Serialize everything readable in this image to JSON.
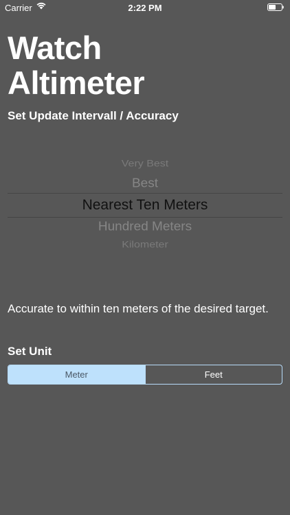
{
  "status_bar": {
    "carrier": "Carrier",
    "time": "2:22 PM",
    "wifi_icon": "wifi-icon",
    "battery_icon": "battery-icon"
  },
  "header": {
    "title_line1": "Watch",
    "title_line2": "Altimeter"
  },
  "accuracy": {
    "label": "Set Update Intervall / Accuracy",
    "options": [
      "Very Best",
      "Best",
      "Nearest Ten Meters",
      "Hundred Meters",
      "Kilometer"
    ],
    "selected": "Nearest Ten Meters",
    "description": "Accurate to within ten meters of the desired target."
  },
  "unit": {
    "label": "Set Unit",
    "options": [
      "Meter",
      "Feet"
    ],
    "selected": "Meter"
  },
  "colors": {
    "background": "#575757",
    "segment_accent": "#bee1fc",
    "segment_border": "#b8dcfa"
  }
}
